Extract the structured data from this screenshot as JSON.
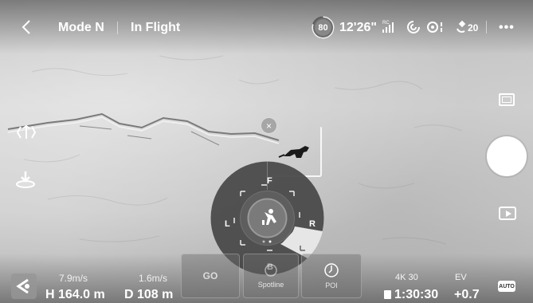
{
  "topbar": {
    "mode": "Mode N",
    "state": "In Flight",
    "battery": "80",
    "flight_time": "12'26\"",
    "rc_label": "RC",
    "satellites": "20",
    "more": "•••"
  },
  "tracking": {
    "close": "×"
  },
  "wheel": {
    "front": "F",
    "back": "B",
    "left": "L",
    "right": "R"
  },
  "bottom": {
    "speed_h": "7.9m/s",
    "speed_v": "1.6m/s",
    "height": "H 164.0 m",
    "distance": "D 108 m",
    "go": "GO",
    "spotlight": "Spotline",
    "poi": "POI",
    "resolution": "4K 30",
    "ev_label": "EV",
    "record_time": "1:30:30",
    "ev_value": "+0.7",
    "auto": "AUTO"
  },
  "colors": {
    "wheel_bg": "#4a4a4a",
    "wheel_highlight": "#e6e6e6",
    "battery": "#888888"
  },
  "icons": [
    "back-icon",
    "rc-signal-icon",
    "gps-icon",
    "vision-icon",
    "satellite-icon",
    "retreat-icon",
    "return-home-icon",
    "photo-mode-icon",
    "playback-icon",
    "map-icon",
    "spotlight-icon",
    "poi-icon",
    "storage-icon"
  ]
}
